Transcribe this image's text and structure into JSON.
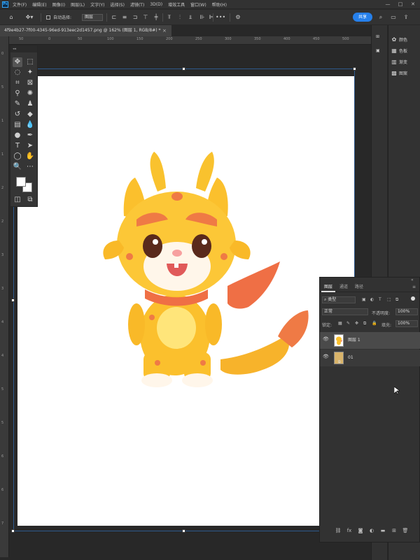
{
  "menubar": {
    "logo": "Ps",
    "items": [
      "文件(F)",
      "编辑(E)",
      "图像(I)",
      "图层(L)",
      "文字(Y)",
      "选择(S)",
      "滤镜(T)",
      "3D(D)",
      "增效工具",
      "窗口(W)",
      "帮助(H)"
    ],
    "min": "—",
    "max": "□",
    "close": "✕"
  },
  "options": {
    "auto_select_label": "自动选择:",
    "layer_select_value": "图层",
    "more": "•••",
    "share_label": "共享"
  },
  "document": {
    "tab_title": "4f9e4b27-7f00-4345-96ed-913eec2d1457.png @ 162% (图层 1, RGB/8#) *",
    "close": "×"
  },
  "ruler": {
    "top_labels": [
      "50",
      "0",
      "50",
      "100",
      "150",
      "200",
      "250",
      "300",
      "350",
      "400",
      "450",
      "500",
      "550"
    ],
    "left_labels": [
      "0",
      "5",
      "1",
      "1",
      "2",
      "2",
      "3",
      "3",
      "4",
      "4",
      "5",
      "5",
      "6",
      "6",
      "7"
    ]
  },
  "dock": {
    "items": [
      {
        "icon": "color-icon",
        "label": "颜色"
      },
      {
        "icon": "swatches-icon",
        "label": "色板"
      },
      {
        "icon": "gradients-icon",
        "label": "渐变"
      },
      {
        "icon": "patterns-icon",
        "label": "图案"
      }
    ]
  },
  "layers": {
    "tabs": [
      "图层",
      "通道",
      "路径"
    ],
    "filter_label": "类型",
    "blend_mode": "正常",
    "opacity_label": "不透明度:",
    "opacity_value": "100%",
    "lock_label": "锁定:",
    "fill_label": "填充:",
    "fill_value": "100%",
    "items": [
      {
        "name": "图层 1",
        "visible": true,
        "selected": true
      },
      {
        "name": "01",
        "visible": true,
        "selected": false
      }
    ]
  },
  "colors": {
    "accent": "#2680eb",
    "panel": "#323232",
    "canvas": "#ffffff"
  }
}
